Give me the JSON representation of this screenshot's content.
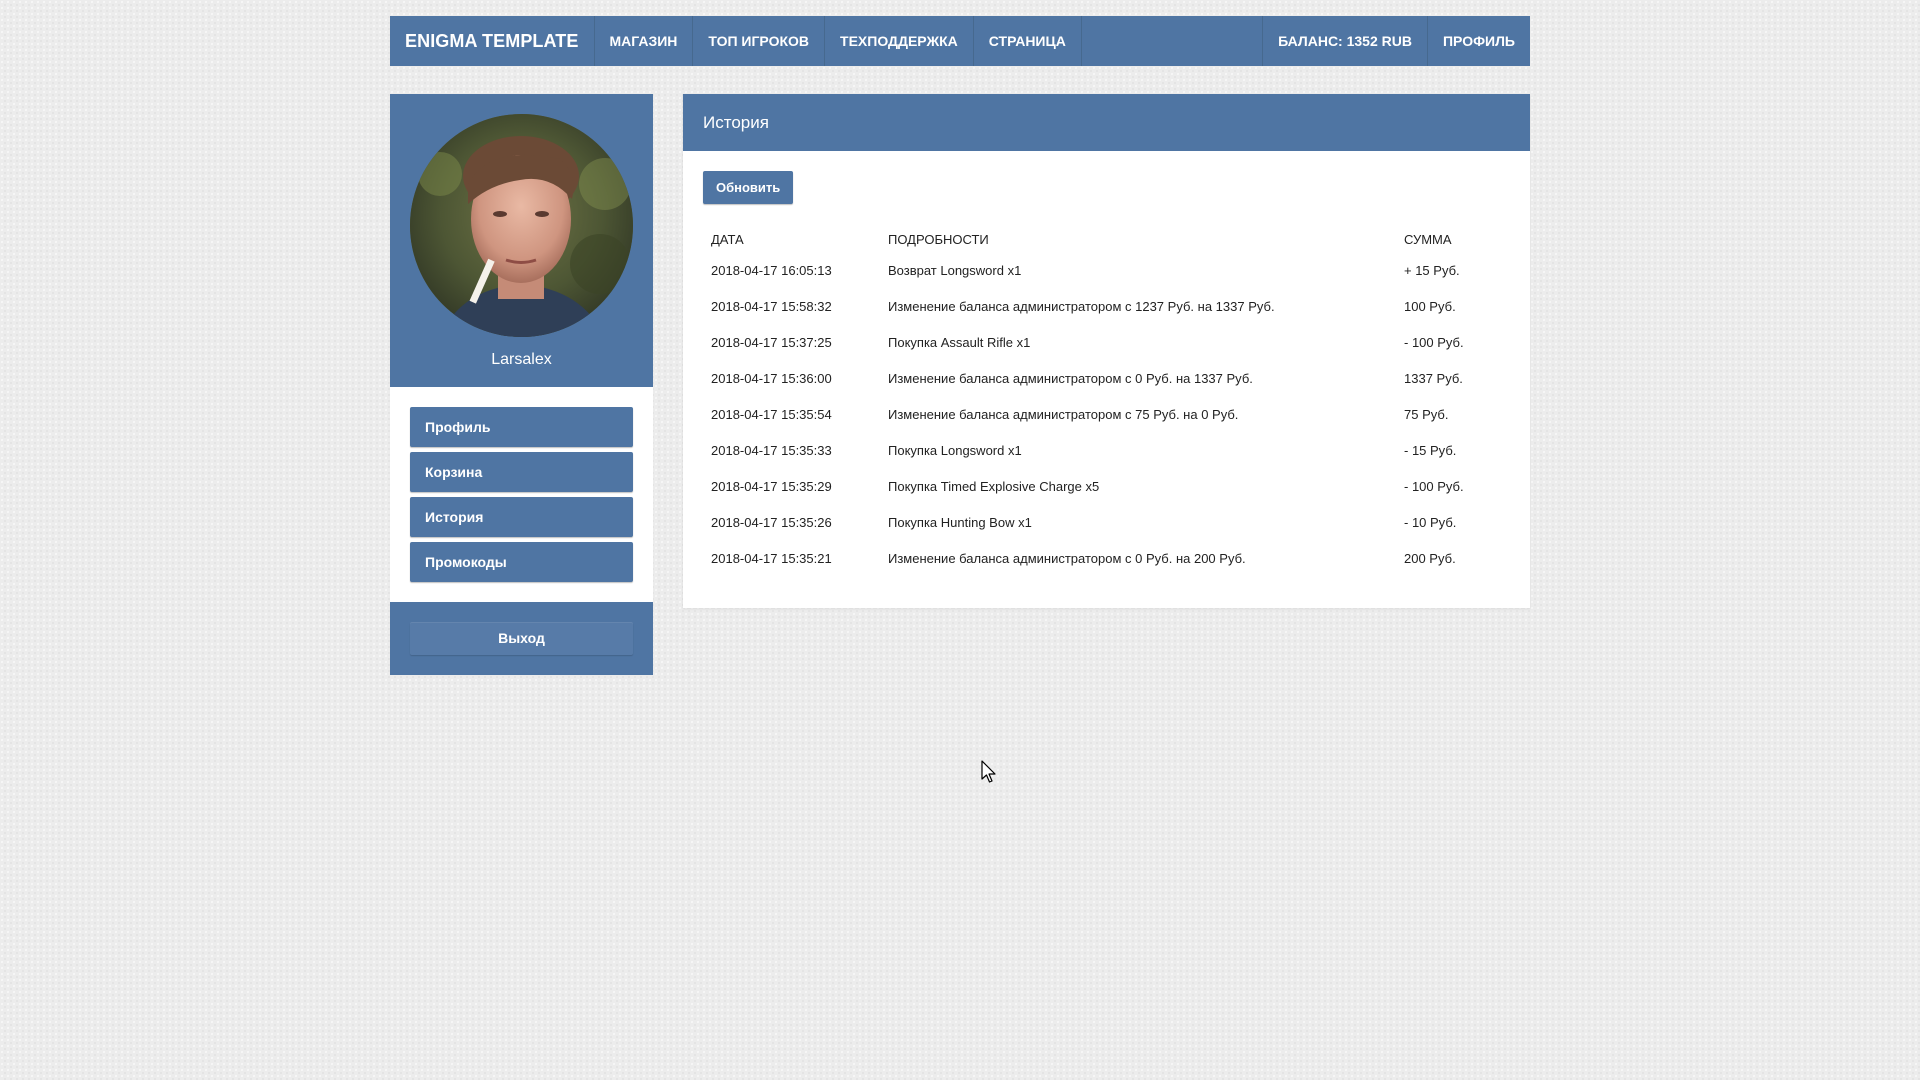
{
  "nav": {
    "brand": "ENIGMA TEMPLATE",
    "links": [
      "МАГАЗИН",
      "ТОП ИГРОКОВ",
      "ТЕХПОДДЕРЖКА",
      "СТРАНИЦА"
    ],
    "balance": "БАЛАНС: 1352 RUB",
    "profile": "ПРОФИЛЬ"
  },
  "sidebar": {
    "username": "Larsalex",
    "menu": [
      "Профиль",
      "Корзина",
      "История",
      "Промокоды"
    ],
    "logout": "Выход"
  },
  "panel": {
    "title": "История",
    "refresh_label": "Обновить",
    "columns": [
      "ДАТА",
      "ПОДРОБНОСТИ",
      "СУММА"
    ],
    "rows": [
      {
        "date": "2018-04-17 16:05:13",
        "details": "Возврат Longsword x1",
        "amount": "+ 15 Руб."
      },
      {
        "date": "2018-04-17 15:58:32",
        "details": "Изменение баланса администратором с 1237 Руб. на 1337 Руб.",
        "amount": "100 Руб."
      },
      {
        "date": "2018-04-17 15:37:25",
        "details": "Покупка Assault Rifle x1",
        "amount": "- 100 Руб."
      },
      {
        "date": "2018-04-17 15:36:00",
        "details": "Изменение баланса администратором с 0 Руб. на 1337 Руб.",
        "amount": "1337 Руб."
      },
      {
        "date": "2018-04-17 15:35:54",
        "details": "Изменение баланса администратором с 75 Руб. на 0 Руб.",
        "amount": "75 Руб."
      },
      {
        "date": "2018-04-17 15:35:33",
        "details": "Покупка Longsword x1",
        "amount": "- 15 Руб."
      },
      {
        "date": "2018-04-17 15:35:29",
        "details": "Покупка Timed Explosive Charge x5",
        "amount": "- 100 Руб."
      },
      {
        "date": "2018-04-17 15:35:26",
        "details": "Покупка Hunting Bow x1",
        "amount": "- 10 Руб."
      },
      {
        "date": "2018-04-17 15:35:21",
        "details": "Изменение баланса администратором с 0 Руб. на 200 Руб.",
        "amount": "200 Руб."
      }
    ]
  },
  "colors": {
    "primary": "#4f75a3",
    "background": "#ececec",
    "panel": "#ffffff"
  },
  "icons": {
    "avatar": "user-photo",
    "cursor": "mouse-pointer-icon"
  }
}
